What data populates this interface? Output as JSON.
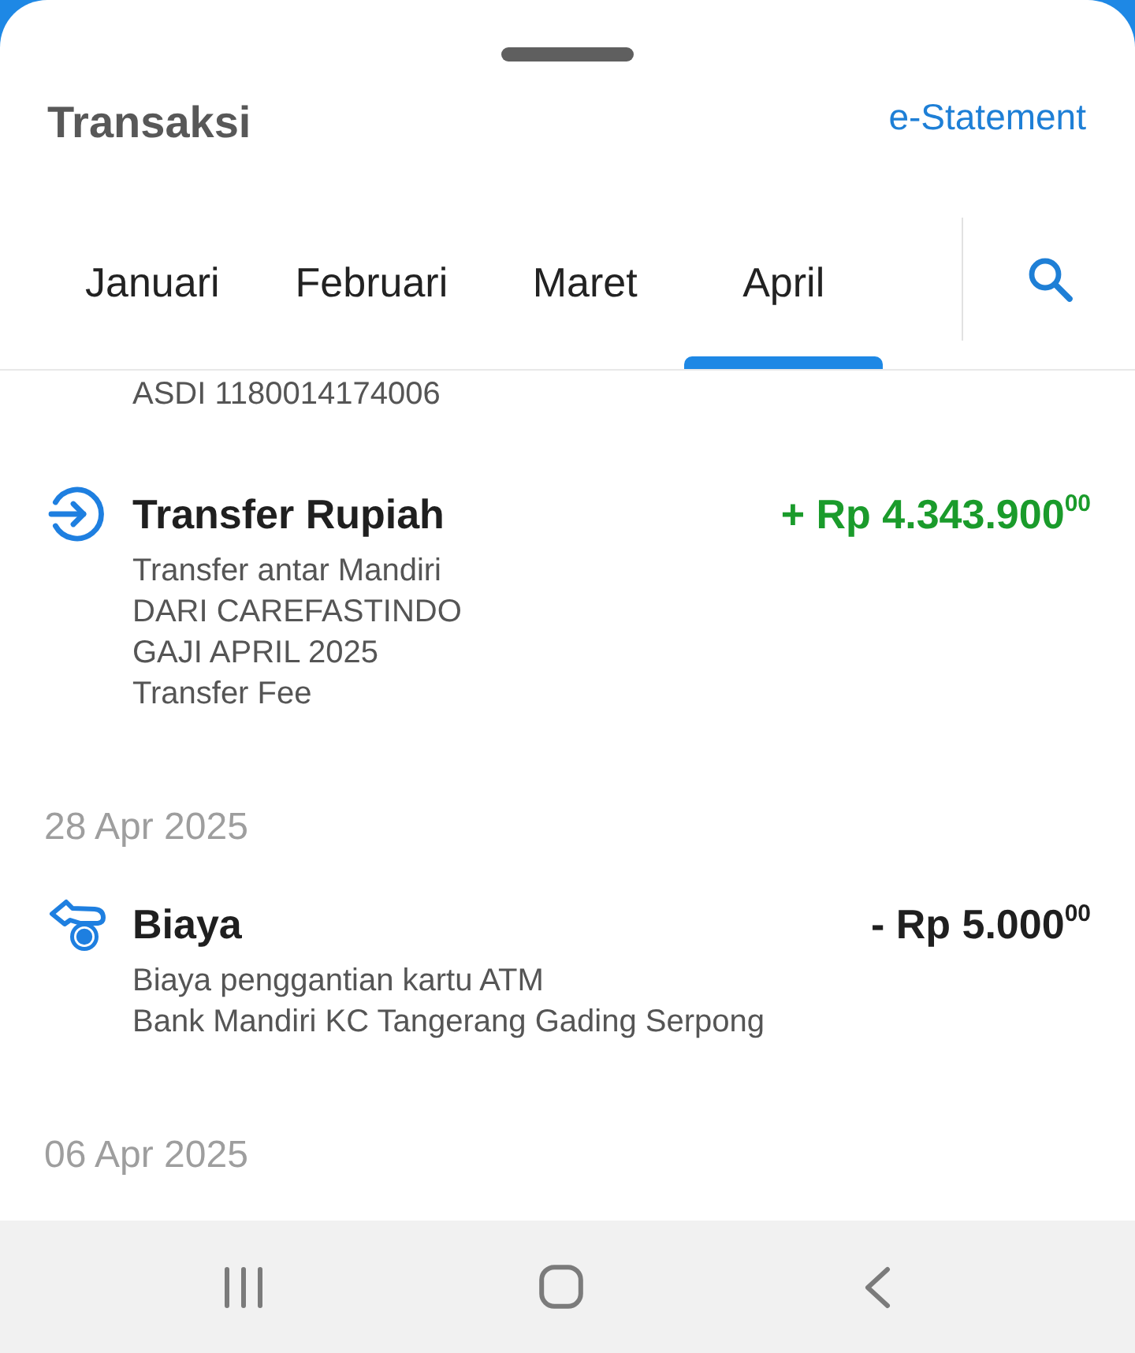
{
  "sheet": {
    "title": "Transaksi",
    "link": "e-Statement"
  },
  "tabs": [
    {
      "label": "Januari",
      "selected": false
    },
    {
      "label": "Februari",
      "selected": false
    },
    {
      "label": "Maret",
      "selected": false
    },
    {
      "label": "April",
      "selected": true
    }
  ],
  "feed": [
    {
      "kind": "detail",
      "text": "ASDI 1180014174006"
    },
    {
      "kind": "transfer",
      "title": "Transfer Rupiah",
      "amount": "+ Rp 4.343.900$^{00}$",
      "incoming": true,
      "description": [
        "Transfer antar Mandiri",
        "DARI CAREFASTINDO",
        "GAJI APRIL 2025",
        "Transfer Fee"
      ]
    },
    {
      "kind": "date",
      "text": "28 Apr 2025"
    },
    {
      "kind": "fee",
      "title": "Biaya",
      "amount": "- Rp 5.000$^{00}$",
      "incoming": false,
      "description": [
        "Biaya penggantian kartu ATM",
        "Bank Mandiri KC Tangerang Gading Serpong"
      ]
    },
    {
      "kind": "date",
      "text": "06 Apr 2025"
    }
  ]
}
